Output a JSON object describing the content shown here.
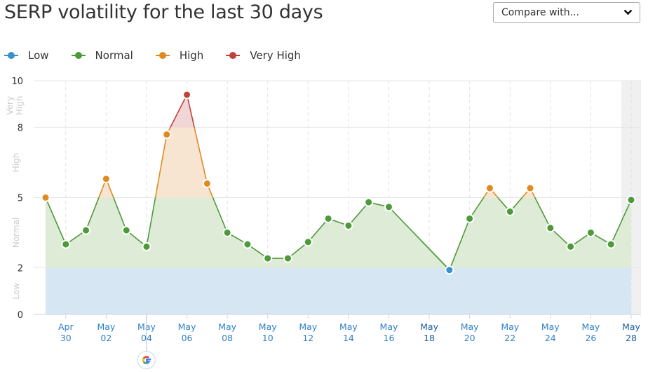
{
  "title": "SERP volatility for the last 30 days",
  "compare_select": {
    "selected": "Compare with...",
    "icon": "chevron-down-icon"
  },
  "legend": [
    {
      "label": "Low",
      "color": "#3a8fce"
    },
    {
      "label": "Normal",
      "color": "#4e9a3a"
    },
    {
      "label": "High",
      "color": "#e08a20"
    },
    {
      "label": "Very High",
      "color": "#c0433a"
    }
  ],
  "google_update_marker": {
    "date": "May 05",
    "icon": "google-icon"
  },
  "chart_data": {
    "type": "line",
    "title": "SERP volatility for the last 30 days",
    "xlabel": "",
    "ylabel": "",
    "ylim": [
      0,
      10
    ],
    "y_ticks": [
      0,
      2,
      5,
      8,
      10
    ],
    "y_bands": [
      {
        "label": "Low",
        "from": 0,
        "to": 2
      },
      {
        "label": "Normal",
        "from": 2,
        "to": 5
      },
      {
        "label": "High",
        "from": 5,
        "to": 8
      },
      {
        "label": "Very High",
        "from": 8,
        "to": 10
      }
    ],
    "band_colors": {
      "Low": "#d6e6f2",
      "Normal": "#deebd7",
      "High": "#f8e5d1",
      "Very High": "#f0d6d6"
    },
    "x_ticks": [
      {
        "m": "Apr",
        "d": "30",
        "day": 1
      },
      {
        "m": "May",
        "d": "02",
        "day": 3
      },
      {
        "m": "May",
        "d": "04",
        "day": 5
      },
      {
        "m": "May",
        "d": "06",
        "day": 7
      },
      {
        "m": "May",
        "d": "08",
        "day": 9
      },
      {
        "m": "May",
        "d": "10",
        "day": 11
      },
      {
        "m": "May",
        "d": "12",
        "day": 13
      },
      {
        "m": "May",
        "d": "14",
        "day": 15
      },
      {
        "m": "May",
        "d": "16",
        "day": 17
      },
      {
        "m": "May",
        "d": "18",
        "day": 19,
        "emphasis": true
      },
      {
        "m": "May",
        "d": "20",
        "day": 21
      },
      {
        "m": "May",
        "d": "22",
        "day": 23
      },
      {
        "m": "May",
        "d": "24",
        "day": 25
      },
      {
        "m": "May",
        "d": "26",
        "day": 27
      },
      {
        "m": "May",
        "d": "28",
        "day": 29,
        "emphasis": true
      }
    ],
    "x_range_days": [
      0,
      29
    ],
    "highlight_last_day": true,
    "points": [
      {
        "date": "Apr 29",
        "day": 0,
        "value": 5.0
      },
      {
        "date": "Apr 30",
        "day": 1,
        "value": 3.0
      },
      {
        "date": "May 01",
        "day": 2,
        "value": 3.6
      },
      {
        "date": "May 02",
        "day": 3,
        "value": 5.8
      },
      {
        "date": "May 03",
        "day": 4,
        "value": 3.6
      },
      {
        "date": "May 04",
        "day": 5,
        "value": 2.9
      },
      {
        "date": "May 05",
        "day": 6,
        "value": 7.7
      },
      {
        "date": "May 06",
        "day": 7,
        "value": 9.4
      },
      {
        "date": "May 07",
        "day": 8,
        "value": 5.6
      },
      {
        "date": "May 08",
        "day": 9,
        "value": 3.5
      },
      {
        "date": "May 09",
        "day": 10,
        "value": 3.0
      },
      {
        "date": "May 10",
        "day": 11,
        "value": 2.4
      },
      {
        "date": "May 11",
        "day": 12,
        "value": 2.4
      },
      {
        "date": "May 12",
        "day": 13,
        "value": 3.1
      },
      {
        "date": "May 13",
        "day": 14,
        "value": 4.1
      },
      {
        "date": "May 14",
        "day": 15,
        "value": 3.8
      },
      {
        "date": "May 15",
        "day": 16,
        "value": 4.8
      },
      {
        "date": "May 16",
        "day": 17,
        "value": 4.6
      },
      {
        "date": "May 19",
        "day": 20,
        "value": 1.9
      },
      {
        "date": "May 20",
        "day": 21,
        "value": 4.1
      },
      {
        "date": "May 21",
        "day": 22,
        "value": 5.4
      },
      {
        "date": "May 22",
        "day": 23,
        "value": 4.4
      },
      {
        "date": "May 23",
        "day": 24,
        "value": 5.4
      },
      {
        "date": "May 24",
        "day": 25,
        "value": 3.7
      },
      {
        "date": "May 25",
        "day": 26,
        "value": 2.9
      },
      {
        "date": "May 26",
        "day": 27,
        "value": 3.5
      },
      {
        "date": "May 27",
        "day": 28,
        "value": 3.0
      },
      {
        "date": "May 28",
        "day": 29,
        "value": 4.9
      }
    ]
  }
}
